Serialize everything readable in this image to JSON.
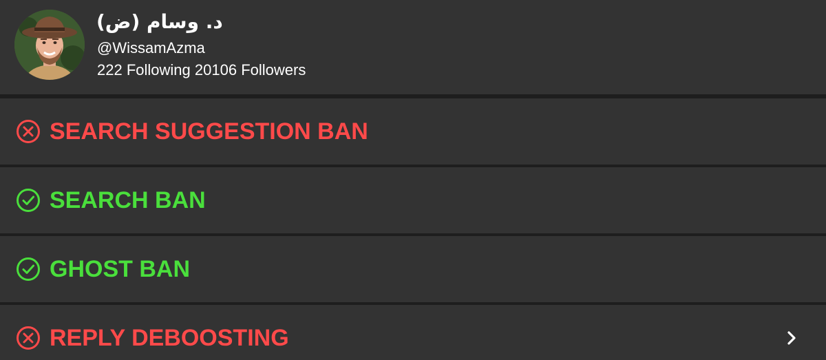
{
  "profile": {
    "display_name": "د. وسام (ض)",
    "handle": "@WissamAzma",
    "following": "222",
    "following_label": "Following",
    "followers": "20106",
    "followers_label": "Followers"
  },
  "checks": [
    {
      "label": "SEARCH SUGGESTION BAN",
      "status": "fail",
      "icon": "x-circle-icon",
      "color": "#ff4a4a"
    },
    {
      "label": "SEARCH BAN",
      "status": "pass",
      "icon": "check-circle-icon",
      "color": "#4adf3c"
    },
    {
      "label": "GHOST BAN",
      "status": "pass",
      "icon": "check-circle-icon",
      "color": "#4adf3c"
    },
    {
      "label": "REPLY DEBOOSTING",
      "status": "fail",
      "icon": "x-circle-icon",
      "color": "#ff4a4a",
      "expandable": true
    }
  ],
  "colors": {
    "background": "#1e1e1e",
    "panel": "#333333",
    "text": "#ffffff",
    "fail": "#ff4a4a",
    "pass": "#4adf3c"
  }
}
